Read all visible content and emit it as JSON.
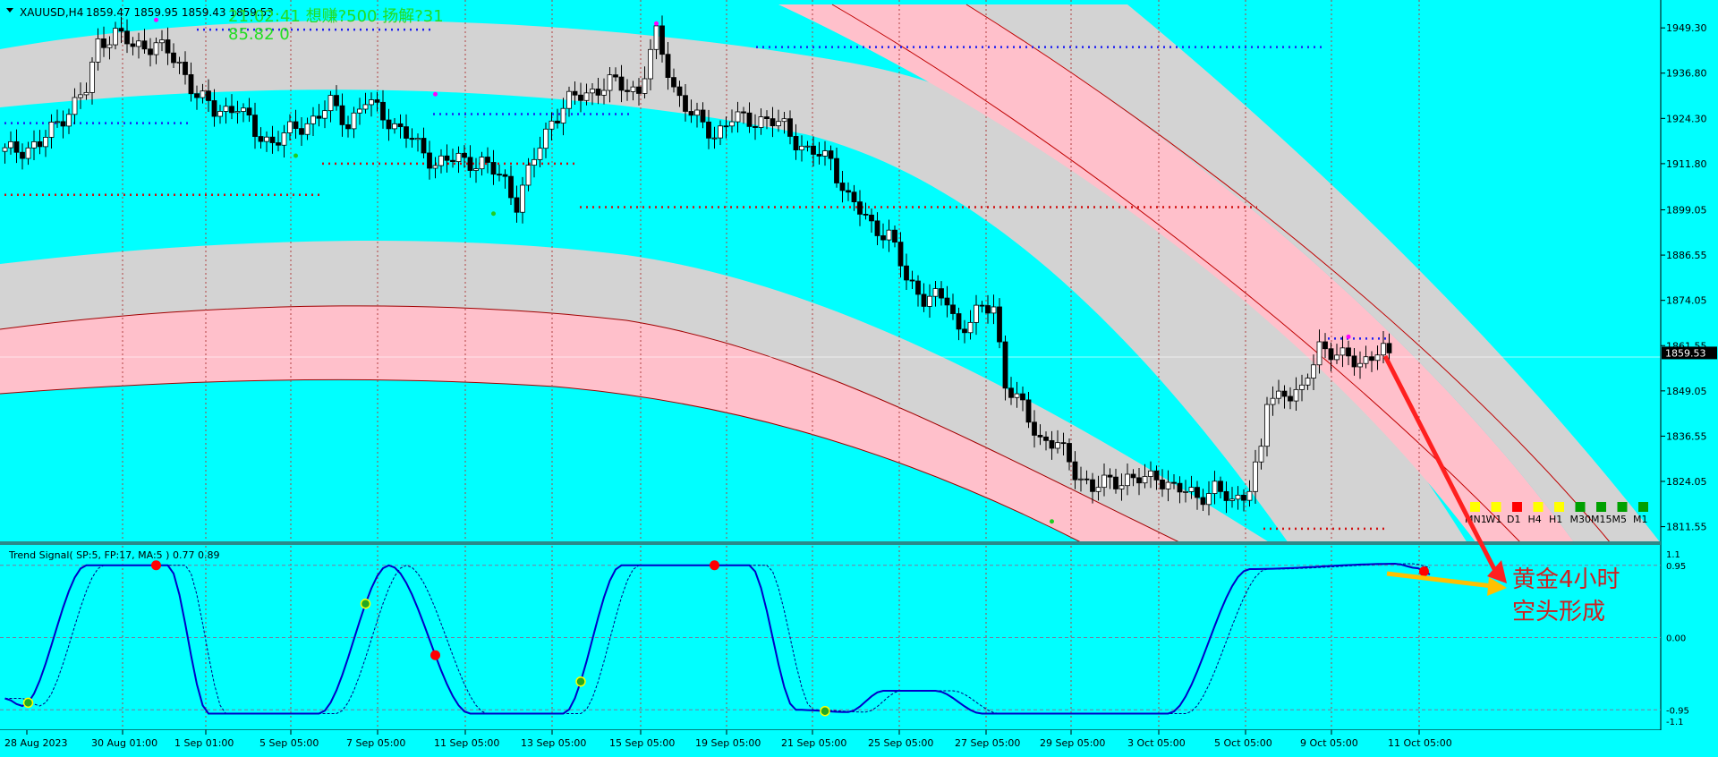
{
  "symbol_line": {
    "symbol": "XAUUSD,H4",
    "ohlc": "1859.47 1859.95 1859.43 1859.53"
  },
  "overlay": {
    "line1": "21:02:41 想赚?500 扬解?31",
    "line2": "85.82 0"
  },
  "annotation": {
    "line1": "黄金4小时",
    "line2": "空头形成"
  },
  "timeframes": [
    "MN1",
    "W1",
    "D1",
    "H4",
    "H1",
    "M30",
    "M15",
    "M5",
    "M1"
  ],
  "timeframe_colors": [
    "#ffff00",
    "#ffff00",
    "#ff0000",
    "#ffff00",
    "#ffff00",
    "#00a000",
    "#00a000",
    "#00a000",
    "#00a000"
  ],
  "indicator": {
    "title": "Trend Signal( SP:5, FP:17, MA:5 ) 0.77 0.89",
    "levels": [
      "1.1",
      "0.95",
      "0.00",
      "-0.95",
      "-1.1"
    ]
  },
  "colors": {
    "background": "#00ffff",
    "band_grey": "#d3d3d3",
    "band_pink": "#ffc0cb",
    "indicator_line": "#0000c8",
    "signal_dot": "#ff0000",
    "arrow": "#ff2020",
    "arrow2": "#ffc000"
  },
  "chart_data": {
    "type": "candlestick",
    "symbol": "XAUUSD",
    "timeframe": "H4",
    "current_price": 1859.53,
    "current_price_label": "1859.53",
    "y_ticks": [
      "1949.30",
      "1936.80",
      "1924.30",
      "1911.80",
      "1899.05",
      "1886.55",
      "1874.05",
      "1861.55",
      "1849.05",
      "1836.55",
      "1824.05",
      "1811.55"
    ],
    "y_tick_values": [
      1949.3,
      1936.8,
      1924.3,
      1911.8,
      1899.05,
      1886.55,
      1874.05,
      1861.55,
      1849.05,
      1836.55,
      1824.05,
      1811.55
    ],
    "ylim": [
      1807,
      1957
    ],
    "x_ticks": [
      "28 Aug 2023",
      "30 Aug 01:00",
      "1 Sep 01:00",
      "5 Sep 05:00",
      "7 Sep 05:00",
      "11 Sep 05:00",
      "13 Sep 05:00",
      "15 Sep 05:00",
      "19 Sep 05:00",
      "21 Sep 05:00",
      "25 Sep 05:00",
      "27 Sep 05:00",
      "29 Sep 05:00",
      "3 Oct 05:00",
      "5 Oct 05:00",
      "9 Oct 05:00",
      "11 Oct 05:00"
    ],
    "candle_count": 205,
    "close_path": [
      [
        0,
        1915
      ],
      [
        6,
        1917
      ],
      [
        10,
        1925
      ],
      [
        14,
        1932
      ],
      [
        16,
        1945
      ],
      [
        19,
        1948
      ],
      [
        22,
        1944
      ],
      [
        26,
        1945
      ],
      [
        30,
        1939
      ],
      [
        33,
        1931
      ],
      [
        36,
        1926
      ],
      [
        40,
        1928
      ],
      [
        43,
        1920
      ],
      [
        46,
        1918
      ],
      [
        51,
        1922
      ],
      [
        56,
        1928
      ],
      [
        59,
        1923
      ],
      [
        62,
        1929
      ],
      [
        66,
        1924
      ],
      [
        70,
        1918
      ],
      [
        74,
        1912
      ],
      [
        78,
        1913
      ],
      [
        82,
        1912
      ],
      [
        86,
        1907
      ],
      [
        88,
        1901
      ],
      [
        91,
        1913
      ],
      [
        94,
        1924
      ],
      [
        97,
        1929
      ],
      [
        101,
        1932
      ],
      [
        104,
        1934
      ],
      [
        109,
        1932
      ],
      [
        112,
        1947
      ],
      [
        115,
        1933
      ],
      [
        118,
        1925
      ],
      [
        122,
        1920
      ],
      [
        125,
        1924
      ],
      [
        130,
        1924
      ],
      [
        134,
        1922
      ],
      [
        138,
        1915
      ],
      [
        142,
        1913
      ],
      [
        145,
        1902
      ],
      [
        149,
        1895
      ],
      [
        152,
        1892
      ],
      [
        155,
        1880
      ],
      [
        158,
        1875
      ],
      [
        162,
        1874
      ],
      [
        164,
        1866
      ],
      [
        167,
        1870
      ],
      [
        170,
        1873
      ],
      [
        172,
        1851
      ],
      [
        175,
        1844
      ],
      [
        178,
        1836
      ],
      [
        181,
        1834
      ],
      [
        184,
        1827
      ],
      [
        187,
        1822
      ],
      [
        190,
        1824
      ],
      [
        193,
        1825
      ],
      [
        196,
        1824
      ],
      [
        198,
        1826
      ],
      [
        201,
        1822
      ],
      [
        205,
        1820
      ],
      [
        208,
        1822
      ],
      [
        211,
        1818
      ],
      [
        214,
        1823
      ],
      [
        216,
        1832
      ],
      [
        217,
        1846
      ],
      [
        220,
        1849
      ],
      [
        223,
        1848
      ],
      [
        226,
        1862
      ],
      [
        230,
        1858
      ],
      [
        233,
        1857
      ],
      [
        236,
        1860
      ],
      [
        238,
        1859.53
      ]
    ],
    "resistance_dots_blue": [
      1948.5,
      1930.5,
      1924.5,
      1863.5
    ],
    "red_dotted_levels": [
      1904,
      1917,
      1900,
      1812
    ],
    "indicator_series": {
      "name": "Trend Signal",
      "range": [
        -1.1,
        1.1
      ],
      "turn_points": [
        [
          0,
          -0.8
        ],
        [
          3,
          -0.9
        ],
        [
          14,
          0.95
        ],
        [
          28,
          0.95
        ],
        [
          35,
          -1.0
        ],
        [
          54,
          -1.0
        ],
        [
          66,
          0.95
        ],
        [
          80,
          -1.0
        ],
        [
          96,
          -1.0
        ],
        [
          106,
          0.95
        ],
        [
          128,
          0.95
        ],
        [
          136,
          -0.95
        ],
        [
          145,
          -0.98
        ],
        [
          151,
          -0.7
        ],
        [
          160,
          -0.7
        ],
        [
          168,
          -1.0
        ],
        [
          200,
          -1.0
        ],
        [
          214,
          0.9
        ],
        [
          239,
          0.97
        ],
        [
          243,
          0.91
        ],
        [
          245,
          0.83
        ]
      ],
      "signal_markers_sell": [
        26,
        74,
        122,
        244
      ],
      "signal_markers_buy": [
        4,
        62,
        99,
        141
      ]
    }
  }
}
